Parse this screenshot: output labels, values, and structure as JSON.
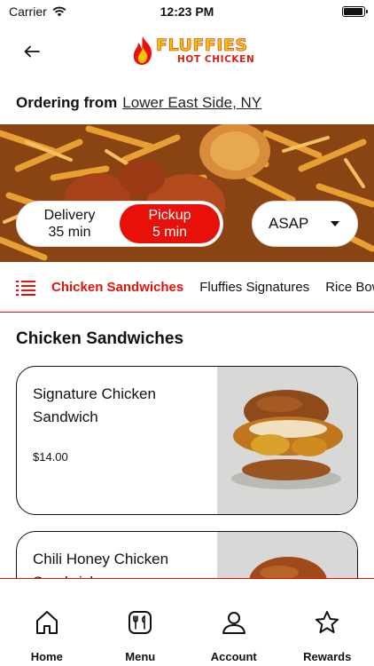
{
  "status_bar": {
    "carrier": "Carrier",
    "time": "12:23 PM",
    "battery_level": 0.95
  },
  "header": {
    "back_icon": "arrow-left-icon",
    "logo": {
      "main": "FLUFFIES",
      "sub": "HOT CHICKEN"
    }
  },
  "ordering": {
    "label": "Ordering from",
    "location": "Lower East Side, NY"
  },
  "order_mode": {
    "delivery": {
      "label": "Delivery",
      "time": "35 min"
    },
    "pickup": {
      "label": "Pickup",
      "time": "5 min"
    },
    "selected": "pickup",
    "time_value": "ASAP"
  },
  "categories": {
    "menu_icon": "list-icon",
    "tabs": [
      {
        "label": "Chicken Sandwiches",
        "active": true
      },
      {
        "label": "Fluffies Signatures",
        "active": false
      },
      {
        "label": "Rice Bowls",
        "active": false
      }
    ]
  },
  "section": {
    "title": "Chicken Sandwiches"
  },
  "items": [
    {
      "name": "Signature Chicken Sandwich",
      "price": "$14.00"
    },
    {
      "name": "Chili Honey Chicken Sandwich",
      "price": ""
    }
  ],
  "bottom_nav": [
    {
      "label": "Home",
      "icon": "home-icon"
    },
    {
      "label": "Menu",
      "icon": "menu-utensils-icon"
    },
    {
      "label": "Account",
      "icon": "account-icon"
    },
    {
      "label": "Rewards",
      "icon": "star-icon"
    }
  ],
  "colors": {
    "accent": "#e8110a",
    "logo_yellow": "#f5c400"
  }
}
